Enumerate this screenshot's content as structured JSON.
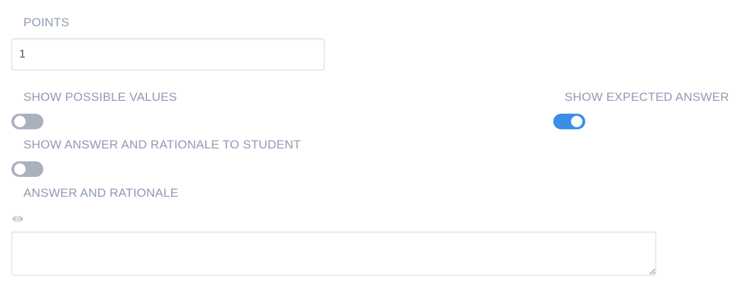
{
  "points": {
    "label": "POINTS",
    "value": "1"
  },
  "show_possible_values": {
    "label": "SHOW POSSIBLE VALUES",
    "enabled": false
  },
  "show_expected_answer": {
    "label": "SHOW EXPECTED ANSWER",
    "enabled": true
  },
  "show_answer_rationale": {
    "label": "SHOW ANSWER AND RATIONALE TO STUDENT",
    "enabled": false
  },
  "answer_rationale": {
    "label": "ANSWER AND RATIONALE",
    "preview_icon": "eye-icon",
    "value": ""
  },
  "colors": {
    "label": "#8f9bb3",
    "toggle_on": "#3b8de8",
    "toggle_off": "#a9b1c1"
  }
}
